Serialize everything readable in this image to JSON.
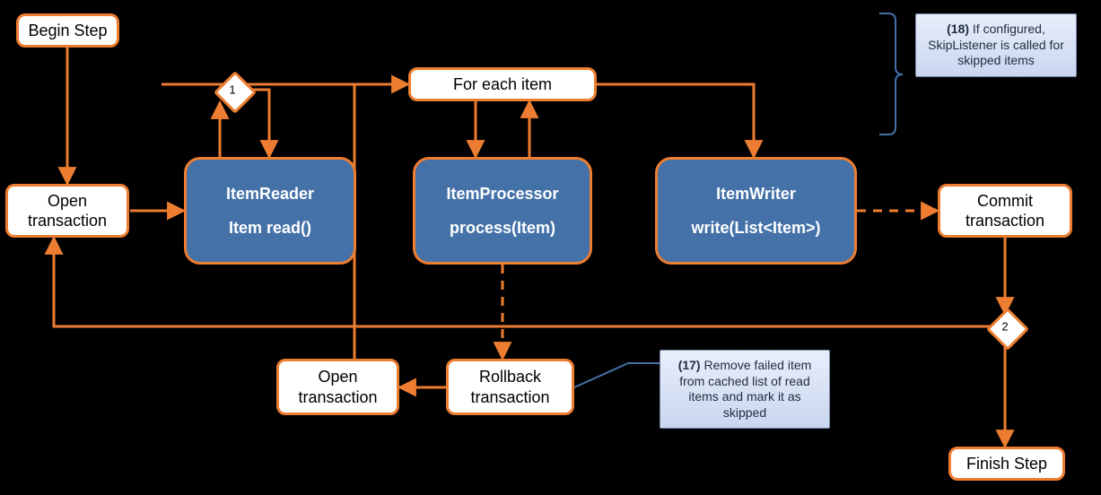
{
  "nodes": {
    "begin_step": "Begin Step",
    "open_tx_1_l1": "Open",
    "open_tx_1_l2": "transaction",
    "item_reader_title": "ItemReader",
    "item_reader_method": "Item read()",
    "for_each_item": "For each item",
    "item_processor_title": "ItemProcessor",
    "item_processor_method": "process(Item)",
    "item_writer_title": "ItemWriter",
    "item_writer_method": "write(List<Item>)",
    "commit_tx_l1": "Commit",
    "commit_tx_l2": "transaction",
    "open_tx_2_l1": "Open",
    "open_tx_2_l2": "transaction",
    "rollback_tx_l1": "Rollback",
    "rollback_tx_l2": "transaction",
    "finish_step": "Finish Step"
  },
  "notes": {
    "note17_bold": "(17)",
    "note17_text": " Remove failed item from cached list of read items and mark it as skipped",
    "note18_bold": "(18)",
    "note18_text": " If configured, SkipListener is called for skipped items"
  },
  "decisions": {
    "d1": "1",
    "d2": "2"
  },
  "colors": {
    "accent": "#ed7d31",
    "blue_box": "#4472a8",
    "note_border": "#7a8aa8"
  }
}
